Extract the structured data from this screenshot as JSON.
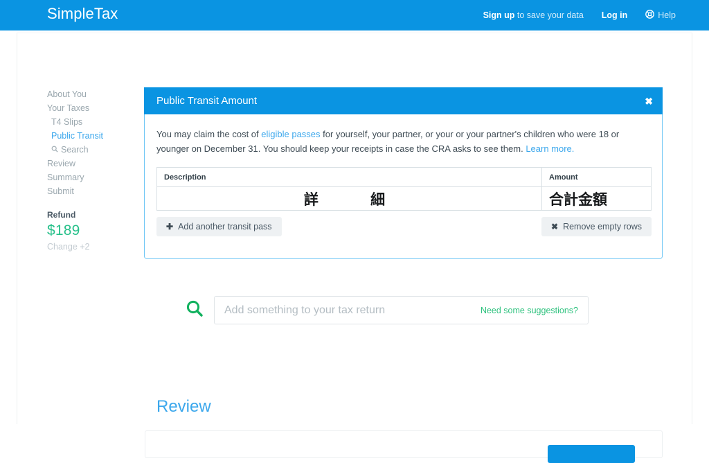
{
  "header": {
    "brand": "SimpleTax",
    "signup_bold": "Sign up",
    "signup_rest": " to save your data",
    "login": "Log in",
    "help": "Help",
    "help_icon": "lifebuoy-icon",
    "background_color": "#0a94e2"
  },
  "sidebar": {
    "items": [
      {
        "label": "About You",
        "state": "normal",
        "indent": false
      },
      {
        "label": "Your Taxes",
        "state": "normal",
        "indent": false
      },
      {
        "label": "T4 Slips",
        "state": "normal",
        "indent": true
      },
      {
        "label": "Public Transit",
        "state": "active",
        "indent": true
      },
      {
        "label": "Search",
        "state": "normal",
        "indent": true,
        "icon": "search-icon"
      },
      {
        "label": "Review",
        "state": "normal",
        "indent": false
      },
      {
        "label": "Summary",
        "state": "normal",
        "indent": false
      },
      {
        "label": "Submit",
        "state": "normal",
        "indent": false
      }
    ],
    "refund": {
      "label": "Refund",
      "amount": "$189",
      "change": "Change +2",
      "amount_color": "#27c08a"
    }
  },
  "modal": {
    "title": "Public Transit Amount",
    "close_glyph": "✖",
    "description_parts": {
      "before_link": "You may claim the cost of ",
      "link1": "eligible passes",
      "middle": " for yourself, your partner, or your or your partner's children who were 18 or younger on December 31. You should keep your receipts in case the CRA asks to see them. ",
      "link2": "Learn more."
    },
    "table": {
      "columns": [
        "Description",
        "Amount"
      ],
      "rows": [
        {
          "description": "詳 細",
          "amount": "合計金額"
        }
      ]
    },
    "buttons": {
      "add": {
        "label": "Add another transit pass",
        "glyph": "✚",
        "icon": "plus-icon"
      },
      "remove": {
        "label": "Remove empty rows",
        "glyph": "✖",
        "icon": "cross-icon"
      }
    }
  },
  "search": {
    "icon": "search-icon",
    "placeholder": "Add something to your tax return",
    "value": "",
    "suggestions_link": "Need some suggestions?",
    "accent_color": "#2ec27e"
  },
  "review": {
    "title": "Review",
    "cta_label": "",
    "cta_color": "#0a94e2"
  }
}
